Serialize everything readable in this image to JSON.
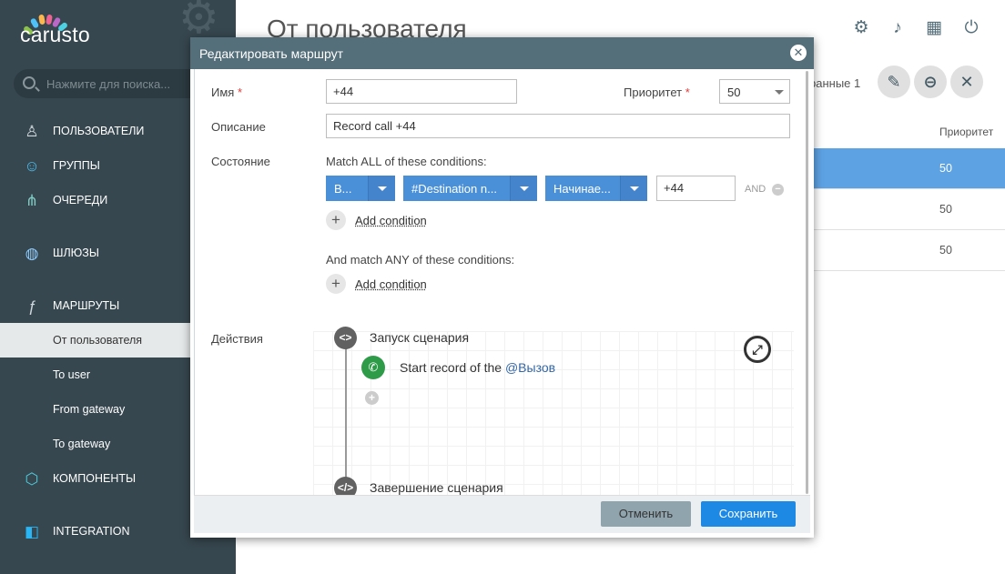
{
  "app": {
    "logo": "carusto"
  },
  "sidebar": {
    "search_placeholder": "Нажмите для поиска...",
    "items": [
      {
        "label": "Пользователи",
        "icon": "user-icon"
      },
      {
        "label": "Группы",
        "icon": "group-icon"
      },
      {
        "label": "Очереди",
        "icon": "queue-icon"
      },
      {
        "label": "Шлюзы",
        "icon": "globe-icon"
      },
      {
        "label": "Маршруты",
        "icon": "function-icon"
      },
      {
        "label": "Компоненты",
        "icon": "cube-icon"
      },
      {
        "label": "Integration",
        "icon": "integration-icon"
      }
    ],
    "sub_items": [
      "От пользователя",
      "To user",
      "From gateway",
      "To gateway"
    ],
    "active_sub": "От пользователя"
  },
  "main": {
    "title": "От пользователя",
    "saved_text": "ранные 1",
    "col_priority": "Приоритет",
    "rows": [
      "50",
      "50",
      "50"
    ]
  },
  "modal": {
    "title": "Редактировать маршрут",
    "name_label": "Имя",
    "name_value": "+44",
    "priority_label": "Приоритет",
    "priority_value": "50",
    "desc_label": "Описание",
    "desc_value": "Record call +44",
    "state_label": "Состояние",
    "match_all": "Match ALL of these conditions:",
    "cond_select1": "В...",
    "cond_select2": "#Destination n...",
    "cond_select3": "Начинае...",
    "cond_value": "+44",
    "and_label": "AND",
    "add_condition": "Add condition",
    "match_any": "And match ANY of these conditions:",
    "actions_label": "Действия",
    "script_start": "Запуск сценария",
    "action_text": "Start record of the",
    "action_link": "@Вызов",
    "script_end": "Завершение сценария",
    "cancel": "Отменить",
    "save": "Сохранить"
  },
  "colors": {
    "sidebar": "#37474f",
    "modal_header": "#546e7a",
    "accent": "#1e88e5",
    "selected_row": "#5da2e3"
  }
}
